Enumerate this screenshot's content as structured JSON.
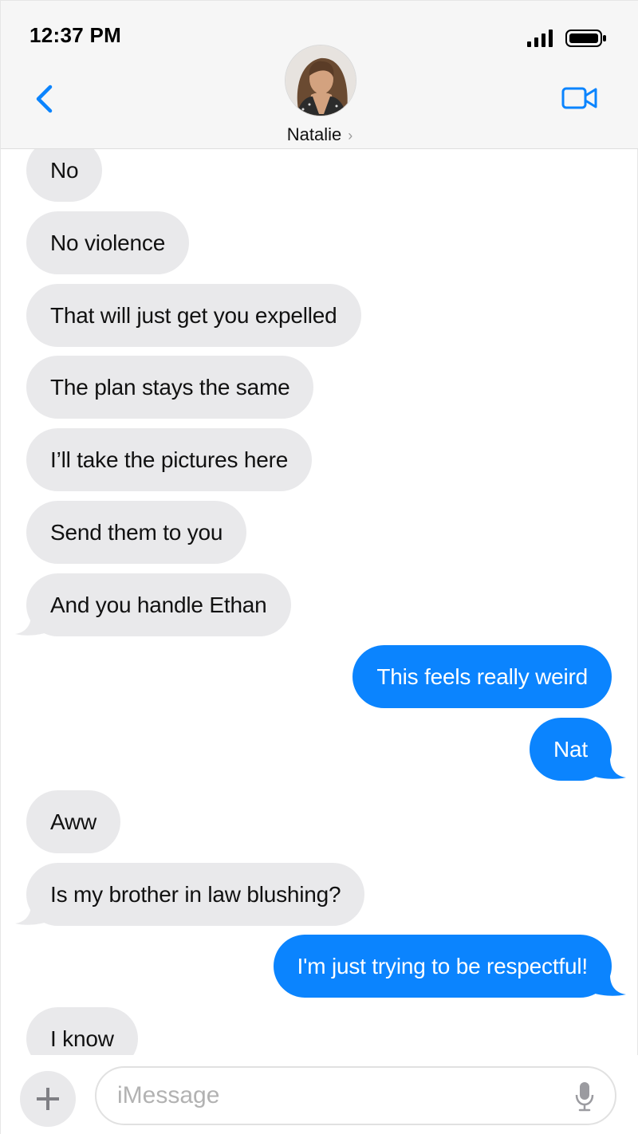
{
  "status_bar": {
    "time": "12:37 PM"
  },
  "header": {
    "contact_name": "Natalie",
    "contact_chevron": "›",
    "icons": {
      "back": "chevron-left-icon",
      "video": "video-camera-icon",
      "signal": "cellular-signal-icon",
      "battery": "battery-icon"
    }
  },
  "messages": [
    {
      "from": "them",
      "text": "No"
    },
    {
      "from": "them",
      "text": "No violence"
    },
    {
      "from": "them",
      "text": "That will just get you expelled"
    },
    {
      "from": "them",
      "text": "The plan stays the same"
    },
    {
      "from": "them",
      "text": "I’ll take the pictures here"
    },
    {
      "from": "them",
      "text": "Send them to you"
    },
    {
      "from": "them",
      "text": "And you handle Ethan"
    },
    {
      "from": "me",
      "text": "This feels really weird"
    },
    {
      "from": "me",
      "text": "Nat"
    },
    {
      "from": "them",
      "text": "Aww"
    },
    {
      "from": "them",
      "text": "Is my brother in law blushing?"
    },
    {
      "from": "me",
      "text": "I'm just trying to be respectful!"
    },
    {
      "from": "them",
      "text": "I know"
    }
  ],
  "composer": {
    "placeholder": "iMessage",
    "value": "",
    "icons": {
      "add": "plus-icon",
      "mic": "microphone-icon"
    }
  },
  "colors": {
    "incoming": "#e9e9eb",
    "outgoing": "#0b84fe",
    "accent": "#0b84fe"
  }
}
